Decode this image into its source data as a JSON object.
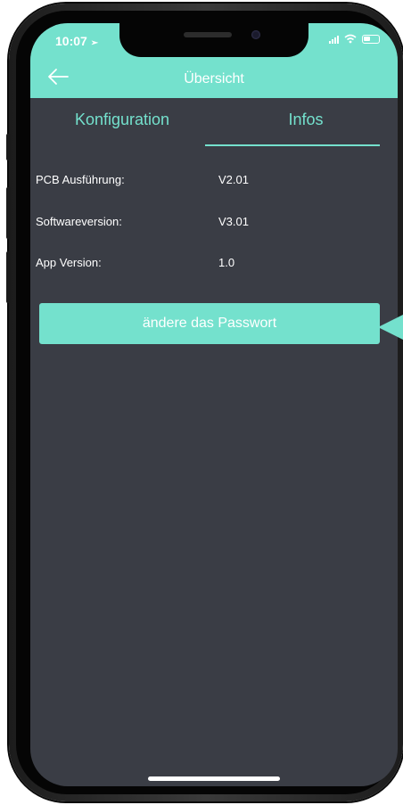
{
  "status": {
    "time": "10:07"
  },
  "appbar": {
    "title": "Übersicht"
  },
  "tabs": [
    {
      "label": "Konfiguration",
      "active": false
    },
    {
      "label": "Infos",
      "active": true
    }
  ],
  "info_rows": [
    {
      "label": "PCB Ausführung:",
      "value": "V2.01"
    },
    {
      "label": "Softwareversion:",
      "value": "V3.01"
    },
    {
      "label": "App Version:",
      "value": "1.0"
    }
  ],
  "actions": {
    "change_password_label": "ändere das Passwort"
  },
  "icons": {
    "back": "arrow-left-icon",
    "location": "location-arrow-icon",
    "wifi": "wifi-icon",
    "battery": "battery-icon"
  },
  "colors": {
    "accent": "#74e1cd",
    "background": "#3a3d45",
    "text": "#ffffff"
  }
}
